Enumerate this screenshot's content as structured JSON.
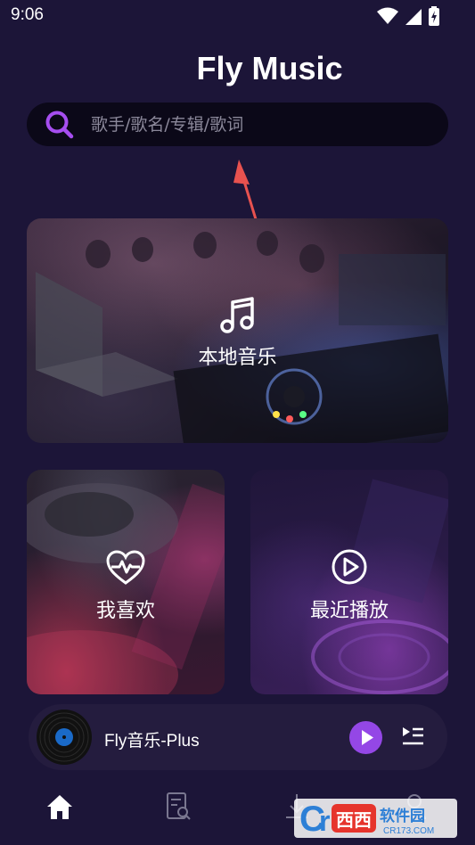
{
  "status_bar": {
    "time": "9:06"
  },
  "app": {
    "title": "Fly Music"
  },
  "search": {
    "placeholder": "歌手/歌名/专辑/歌词"
  },
  "cards": {
    "local": {
      "label": "本地音乐",
      "icon": "music-note-icon"
    },
    "favorites": {
      "label": "我喜欢",
      "icon": "heart-pulse-icon"
    },
    "recent": {
      "label": "最近播放",
      "icon": "play-circle-icon"
    }
  },
  "player": {
    "title": "Fly音乐-Plus"
  },
  "bottom_nav": [
    {
      "icon": "home-icon",
      "active": true
    },
    {
      "icon": "search-list-icon",
      "active": false
    },
    {
      "icon": "download-icon",
      "active": false
    },
    {
      "icon": "user-icon",
      "active": false
    }
  ],
  "watermark": {
    "brand": "西西",
    "text": "软件园",
    "site": "CR173.COM"
  },
  "colors": {
    "accent": "#9447e6",
    "background": "#1c1538",
    "search_icon": "#a64ef0"
  }
}
